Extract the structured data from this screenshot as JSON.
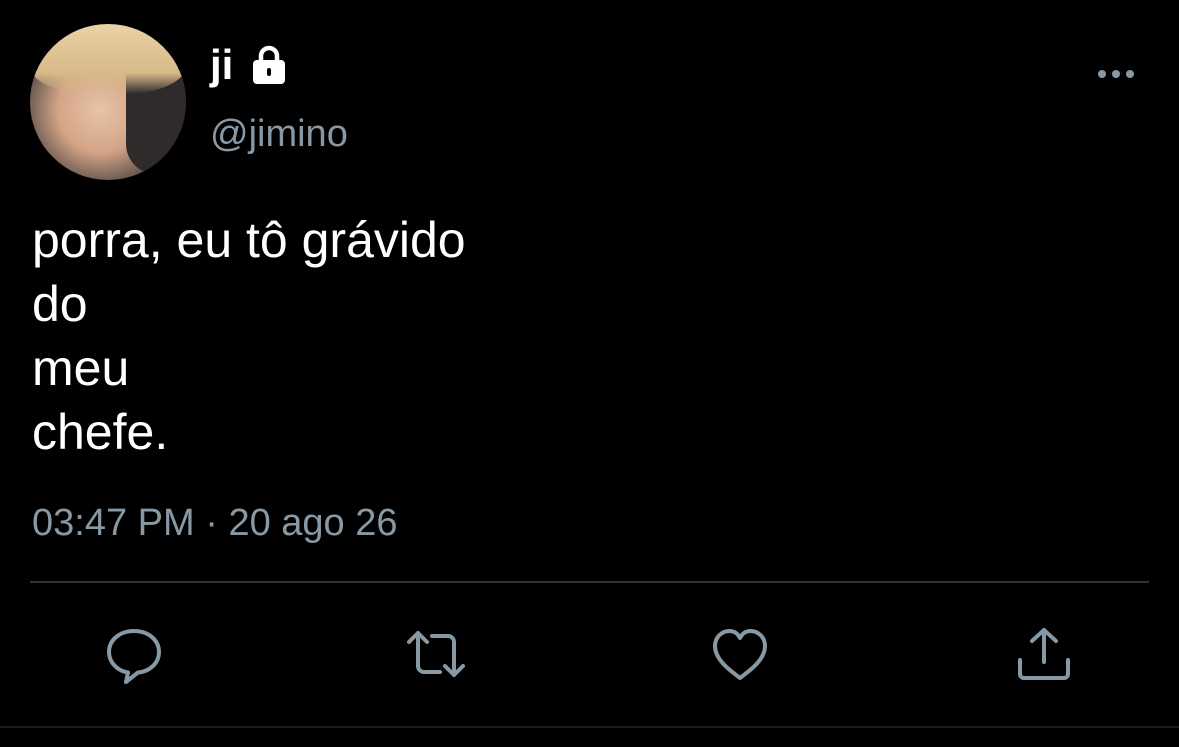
{
  "user": {
    "name": "ji",
    "handle": "@jimino",
    "protected_icon": "lock-icon",
    "avatar_icon": "avatar"
  },
  "tweet": {
    "lines": [
      "porra, eu tô grávido",
      "do",
      "meu",
      "chefe."
    ]
  },
  "meta": {
    "time": "03:47 PM",
    "separator": " · ",
    "date": "20 ago 26"
  },
  "menu": {
    "icon": "more-horizontal-icon"
  },
  "actions": [
    {
      "icon": "reply-icon"
    },
    {
      "icon": "retweet-icon"
    },
    {
      "icon": "like-icon"
    },
    {
      "icon": "share-icon"
    }
  ],
  "colors": {
    "background": "#000000",
    "text": "#ffffff",
    "secondary": "#8899a6",
    "divider": "#2f3336"
  }
}
